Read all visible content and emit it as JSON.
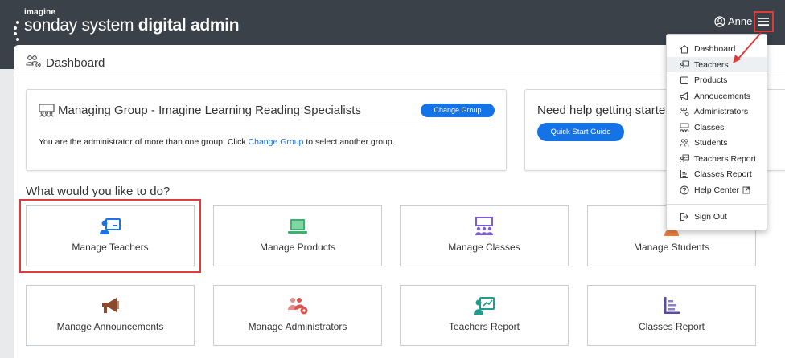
{
  "header": {
    "logo_small": "imagine",
    "logo_light": "sonday system",
    "logo_bold": "digital admin",
    "user_name": "Anne",
    "icons": [
      "user-circle-icon",
      "hamburger-menu-icon"
    ]
  },
  "dashboard": {
    "title": "Dashboard",
    "icon": "users-gear-icon"
  },
  "group_card": {
    "title": "Managing Group - Imagine Learning Reading Specialists",
    "change_button": "Change Group",
    "message_before": "You are the administrator of more than one group. Click ",
    "message_link": "Change Group",
    "message_after": " to select another group."
  },
  "help_card": {
    "title": "Need help getting starte",
    "button": "Quick Start Guide"
  },
  "question": "What would you like to do?",
  "tiles": [
    {
      "label": "Manage Teachers",
      "icon": "teacher-board-icon"
    },
    {
      "label": "Manage Products",
      "icon": "laptop-icon"
    },
    {
      "label": "Manage Classes",
      "icon": "classroom-icon"
    },
    {
      "label": "Manage Students",
      "icon": "student-icon"
    },
    {
      "label": "Manage Announcements",
      "icon": "megaphone-icon"
    },
    {
      "label": "Manage Administrators",
      "icon": "admin-users-gear-icon"
    },
    {
      "label": "Teachers Report",
      "icon": "teacher-report-icon"
    },
    {
      "label": "Classes Report",
      "icon": "bar-report-icon"
    }
  ],
  "menu": {
    "items": [
      {
        "label": "Dashboard",
        "icon": "home-icon"
      },
      {
        "label": "Teachers",
        "icon": "teacher-board-icon"
      },
      {
        "label": "Products",
        "icon": "box-icon"
      },
      {
        "label": "Annoucements",
        "icon": "megaphone-icon"
      },
      {
        "label": "Administrators",
        "icon": "users-gear-icon"
      },
      {
        "label": "Classes",
        "icon": "classroom-icon"
      },
      {
        "label": "Students",
        "icon": "student-icon"
      },
      {
        "label": "Teachers Report",
        "icon": "teacher-report-icon"
      },
      {
        "label": "Classes Report",
        "icon": "bar-report-icon"
      },
      {
        "label": "Help Center",
        "icon": "help-circle-icon"
      }
    ],
    "signout": {
      "label": "Sign Out",
      "icon": "sign-out-icon"
    }
  },
  "colors": {
    "header_bg": "#3a4149",
    "accent_blue": "#1473e6",
    "highlight_red": "#e03b3b",
    "tile_teachers": "#1a73e8",
    "tile_products": "#3cb371",
    "tile_classes": "#7b5bd6",
    "tile_students": "#f08040",
    "tile_announcements": "#8b4a2b",
    "tile_admins": "#d9534f",
    "tile_reports_teal": "#1f9e8f",
    "tile_reports_purple": "#5b4ba6"
  }
}
